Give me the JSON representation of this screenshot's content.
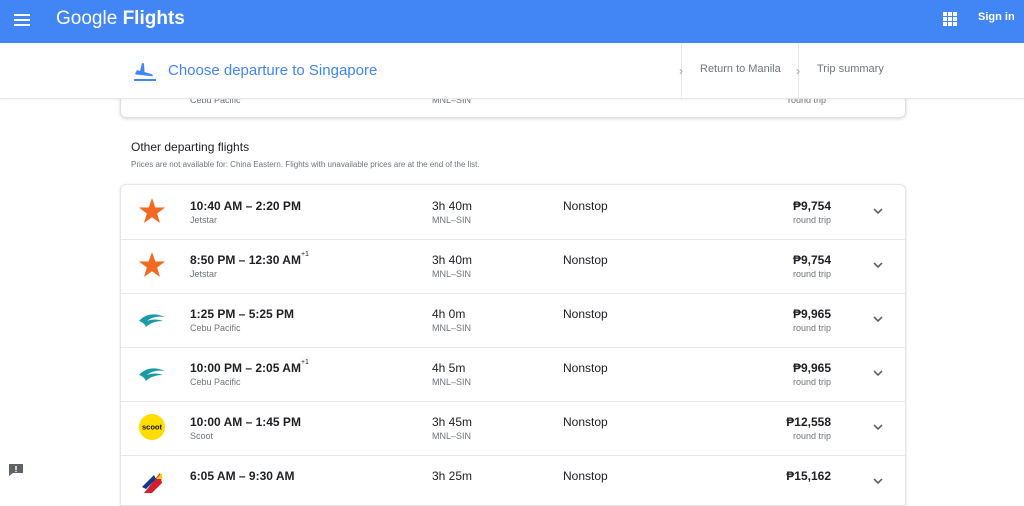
{
  "app": {
    "brand_google": "Google",
    "brand_product": "Flights",
    "signin_label": "Sign in"
  },
  "header": {
    "title": "Choose departure to Singapore",
    "steps": [
      "Return to Manila",
      "Trip summary"
    ]
  },
  "peek": {
    "airline": "Cebu Pacific",
    "route": "MNL–SIN",
    "price_type": "round trip"
  },
  "section": {
    "title": "Other departing flights",
    "note": "Prices are not available for: China Eastern. Flights with unavailable prices are at the end of the list."
  },
  "flights": [
    {
      "times": "10:40 AM – 2:20 PM",
      "day_offset": "",
      "airline": "Jetstar",
      "duration": "3h 40m",
      "route": "MNL–SIN",
      "stops": "Nonstop",
      "price": "₱9,754",
      "price_type": "round trip",
      "logo": "jetstar-star"
    },
    {
      "times": "8:50 PM – 12:30 AM",
      "day_offset": "+1",
      "airline": "Jetstar",
      "duration": "3h 40m",
      "route": "MNL–SIN",
      "stops": "Nonstop",
      "price": "₱9,754",
      "price_type": "round trip",
      "logo": "jetstar-star"
    },
    {
      "times": "1:25 PM – 5:25 PM",
      "day_offset": "",
      "airline": "Cebu Pacific",
      "duration": "4h 0m",
      "route": "MNL–SIN",
      "stops": "Nonstop",
      "price": "₱9,965",
      "price_type": "round trip",
      "logo": "cebu-pacific-wave"
    },
    {
      "times": "10:00 PM – 2:05 AM",
      "day_offset": "+1",
      "airline": "Cebu Pacific",
      "duration": "4h 5m",
      "route": "MNL–SIN",
      "stops": "Nonstop",
      "price": "₱9,965",
      "price_type": "round trip",
      "logo": "cebu-pacific-wave"
    },
    {
      "times": "10:00 AM – 1:45 PM",
      "day_offset": "",
      "airline": "Scoot",
      "duration": "3h 45m",
      "route": "MNL–SIN",
      "stops": "Nonstop",
      "price": "₱12,558",
      "price_type": "round trip",
      "logo": "scoot-circle"
    },
    {
      "times": "6:05 AM – 9:30 AM",
      "day_offset": "",
      "airline": "",
      "duration": "3h 25m",
      "route": "",
      "stops": "Nonstop",
      "price": "₱15,162",
      "price_type": "",
      "logo": "philippine-airlines-tail"
    }
  ],
  "colors": {
    "appbar": "#4285f4",
    "jetstar": "#f26a21",
    "cebu": "#1a9aa5",
    "scoot": "#ffdd00",
    "pal_red": "#d4202c",
    "pal_blue": "#0b3a8c"
  }
}
